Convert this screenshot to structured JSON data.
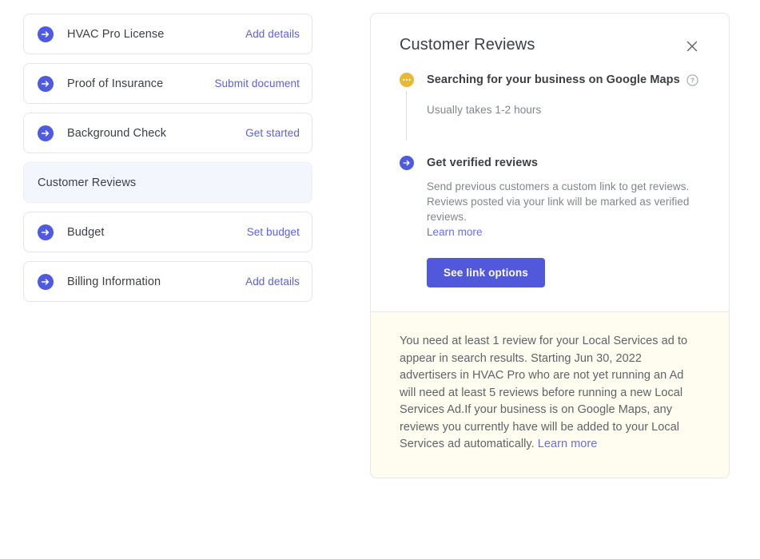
{
  "sidebar": {
    "items": [
      {
        "label": "HVAC Pro License",
        "action": "Add details",
        "icon": "arrow-circle-icon",
        "selected": false
      },
      {
        "label": "Proof of Insurance",
        "action": "Submit document",
        "icon": "arrow-circle-icon",
        "selected": false
      },
      {
        "label": "Background Check",
        "action": "Get started",
        "icon": "arrow-circle-icon",
        "selected": false
      },
      {
        "label": "Customer Reviews",
        "action": "",
        "icon": "",
        "selected": true
      },
      {
        "label": "Budget",
        "action": "Set budget",
        "icon": "arrow-circle-icon",
        "selected": false
      },
      {
        "label": "Billing Information",
        "action": "Add details",
        "icon": "arrow-circle-icon",
        "selected": false
      }
    ]
  },
  "panel": {
    "title": "Customer Reviews",
    "close_icon": "close-icon",
    "steps": [
      {
        "icon": "pending-dots-icon",
        "title": "Searching for your business on Google Maps",
        "help_icon": "help-circle-icon",
        "sub": "Usually takes 1-2 hours"
      },
      {
        "icon": "arrow-circle-icon",
        "title": "Get verified reviews",
        "desc_line1": "Send previous customers a custom link to get reviews.",
        "desc_line2": "Reviews posted via your link will be marked as verified reviews.",
        "learn_more": "Learn more",
        "cta_label": "See link options"
      }
    ],
    "notice": {
      "text": "You need at least 1 review for your Local Services ad to appear in search results. Starting Jun 30, 2022 advertisers in HVAC Pro who are not yet running an Ad will need at least 5 reviews before running a new Local Services Ad.If your business is on Google Maps, any reviews you currently have will be added to your Local Services ad automatically.",
      "learn_more": "Learn more"
    }
  },
  "colors": {
    "accent": "#5158d9",
    "link": "#5c61d8",
    "pending": "#e8b936",
    "notice_bg": "#fefdf0",
    "selected_bg": "#f3f6fd"
  }
}
